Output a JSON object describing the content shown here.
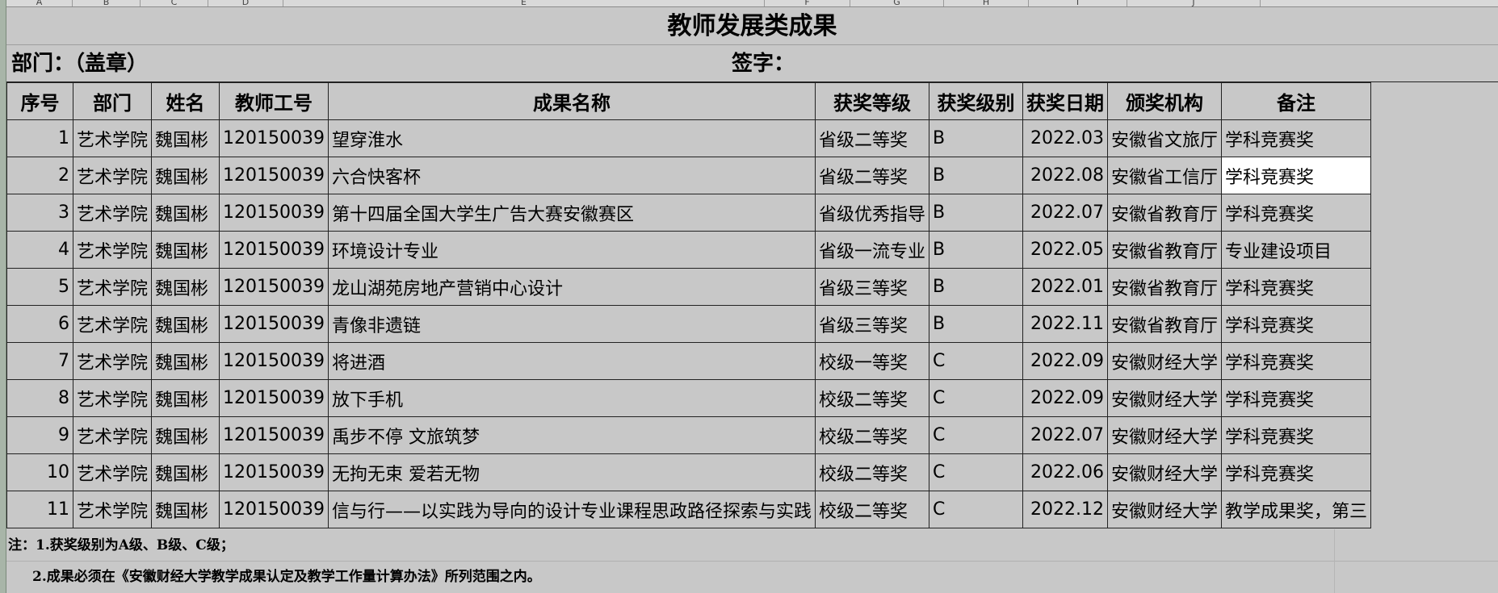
{
  "column_headers": [
    "A",
    "B",
    "C",
    "D",
    "E",
    "F",
    "G",
    "H",
    "I",
    "J"
  ],
  "title": "教师发展类成果",
  "sign_row": {
    "dept": "部门：（盖章）",
    "sign": "签字："
  },
  "table": {
    "headers": [
      "序号",
      "部门",
      "姓名",
      "教师工号",
      "成果名称",
      "获奖等级",
      "获奖级别",
      "获奖日期",
      "颁奖机构",
      "备注"
    ],
    "rows": [
      [
        "1",
        "艺术学院",
        "魏国彬",
        "120150039",
        "望穿淮水",
        "省级二等奖",
        "B",
        "2022.03",
        "安徽省文旅厅",
        "学科竞赛奖"
      ],
      [
        "2",
        "艺术学院",
        "魏国彬",
        "120150039",
        "六合快客杯",
        "省级二等奖",
        "B",
        "2022.08",
        "安徽省工信厅",
        "学科竞赛奖"
      ],
      [
        "3",
        "艺术学院",
        "魏国彬",
        "120150039",
        "第十四届全国大学生广告大赛安徽赛区",
        "省级优秀指导",
        "B",
        "2022.07",
        "安徽省教育厅",
        "学科竞赛奖"
      ],
      [
        "4",
        "艺术学院",
        "魏国彬",
        "120150039",
        "环境设计专业",
        "省级一流专业",
        "B",
        "2022.05",
        "安徽省教育厅",
        "专业建设项目"
      ],
      [
        "5",
        "艺术学院",
        "魏国彬",
        "120150039",
        "龙山湖苑房地产营销中心设计",
        "省级三等奖",
        "B",
        "2022.01",
        "安徽省教育厅",
        "学科竞赛奖"
      ],
      [
        "6",
        "艺术学院",
        "魏国彬",
        "120150039",
        "青像非遗链",
        "省级三等奖",
        "B",
        "2022.11",
        "安徽省教育厅",
        "学科竞赛奖"
      ],
      [
        "7",
        "艺术学院",
        "魏国彬",
        "120150039",
        "将进酒",
        "校级一等奖",
        "C",
        "2022.09",
        "安徽财经大学",
        "学科竞赛奖"
      ],
      [
        "8",
        "艺术学院",
        "魏国彬",
        "120150039",
        "放下手机",
        "校级二等奖",
        "C",
        "2022.09",
        "安徽财经大学",
        "学科竞赛奖"
      ],
      [
        "9",
        "艺术学院",
        "魏国彬",
        "120150039",
        "禹步不停 文旅筑梦",
        "校级二等奖",
        "C",
        "2022.07",
        "安徽财经大学",
        "学科竞赛奖"
      ],
      [
        "10",
        "艺术学院",
        "魏国彬",
        "120150039",
        "无拘无束 爱若无物",
        "校级二等奖",
        "C",
        "2022.06",
        "安徽财经大学",
        "学科竞赛奖"
      ],
      [
        "11",
        "艺术学院",
        "魏国彬",
        "120150039",
        "信与行——以实践为导向的设计专业课程思政路径探索与实践",
        "校级二等奖",
        "C",
        "2022.12",
        "安徽财经大学",
        "教学成果奖，第三"
      ]
    ]
  },
  "notes": {
    "line1": "注：1.获奖级别为A级、B级、C级；",
    "line2": "2.成果必须在《安徽财经大学教学成果认定及教学工作量计算办法》所列范围之内。"
  },
  "colors": {
    "background": "#c8c8c8",
    "selected_cell": "#ffffff",
    "grid_border": "#222222"
  }
}
